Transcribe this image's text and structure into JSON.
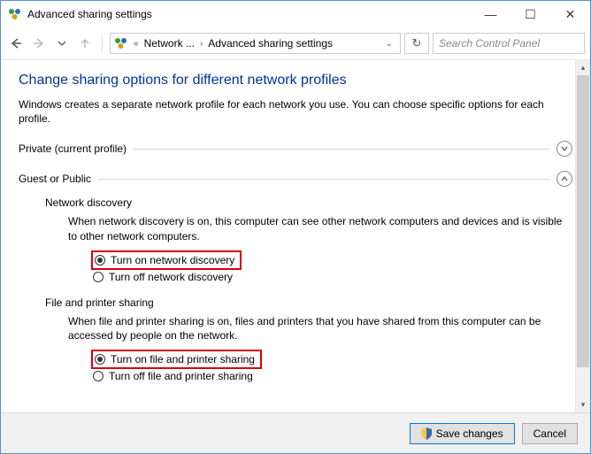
{
  "window": {
    "title": "Advanced sharing settings",
    "min": "—",
    "max": "☐",
    "close": "✕"
  },
  "breadcrumb": {
    "item1": "Network ...",
    "item2": "Advanced sharing settings"
  },
  "search": {
    "placeholder": "Search Control Panel"
  },
  "heading": "Change sharing options for different network profiles",
  "description": "Windows creates a separate network profile for each network you use. You can choose specific options for each profile.",
  "sections": {
    "private": {
      "label": "Private (current profile)"
    },
    "guest": {
      "label": "Guest or Public"
    }
  },
  "network_discovery": {
    "title": "Network discovery",
    "desc": "When network discovery is on, this computer can see other network computers and devices and is visible to other network computers.",
    "on": "Turn on network discovery",
    "off": "Turn off network discovery"
  },
  "file_printer": {
    "title": "File and printer sharing",
    "desc": "When file and printer sharing is on, files and printers that you have shared from this computer can be accessed by people on the network.",
    "on": "Turn on file and printer sharing",
    "off": "Turn off file and printer sharing"
  },
  "footer": {
    "save": "Save changes",
    "cancel": "Cancel"
  }
}
